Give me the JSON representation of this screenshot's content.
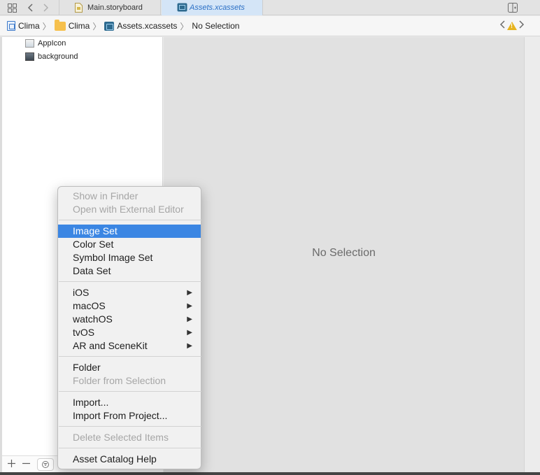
{
  "tabs": [
    {
      "label": "Main.storyboard",
      "icon": "storyboard-file-icon",
      "active": false
    },
    {
      "label": "Assets.xcassets",
      "icon": "asset-catalog-icon",
      "active": true
    }
  ],
  "jumpbar": {
    "crumbs": [
      "Clima",
      "Clima",
      "Assets.xcassets",
      "No Selection"
    ]
  },
  "navigator": {
    "assets": [
      {
        "label": "AppIcon",
        "icon": "app-icon-image-icon"
      },
      {
        "label": "background",
        "icon": "image-set-icon"
      }
    ]
  },
  "editor": {
    "empty_label": "No Selection"
  },
  "context_menu": {
    "items": [
      {
        "label": "Show in Finder",
        "disabled": true
      },
      {
        "label": "Open with External Editor",
        "disabled": true
      },
      {
        "label": "Image Set",
        "selected": true
      },
      {
        "label": "Color Set"
      },
      {
        "label": "Symbol Image Set"
      },
      {
        "label": "Data Set"
      },
      {
        "label": "iOS",
        "submenu": true
      },
      {
        "label": "macOS",
        "submenu": true
      },
      {
        "label": "watchOS",
        "submenu": true
      },
      {
        "label": "tvOS",
        "submenu": true
      },
      {
        "label": "AR and SceneKit",
        "submenu": true
      },
      {
        "label": "Folder"
      },
      {
        "label": "Folder from Selection",
        "disabled": true
      },
      {
        "label": "Import..."
      },
      {
        "label": "Import From Project..."
      },
      {
        "label": "Delete Selected Items",
        "disabled": true
      },
      {
        "label": "Asset Catalog Help"
      }
    ],
    "colors": {
      "highlight": "#3b86e3",
      "disabled_text": "#a6a6a6"
    }
  }
}
